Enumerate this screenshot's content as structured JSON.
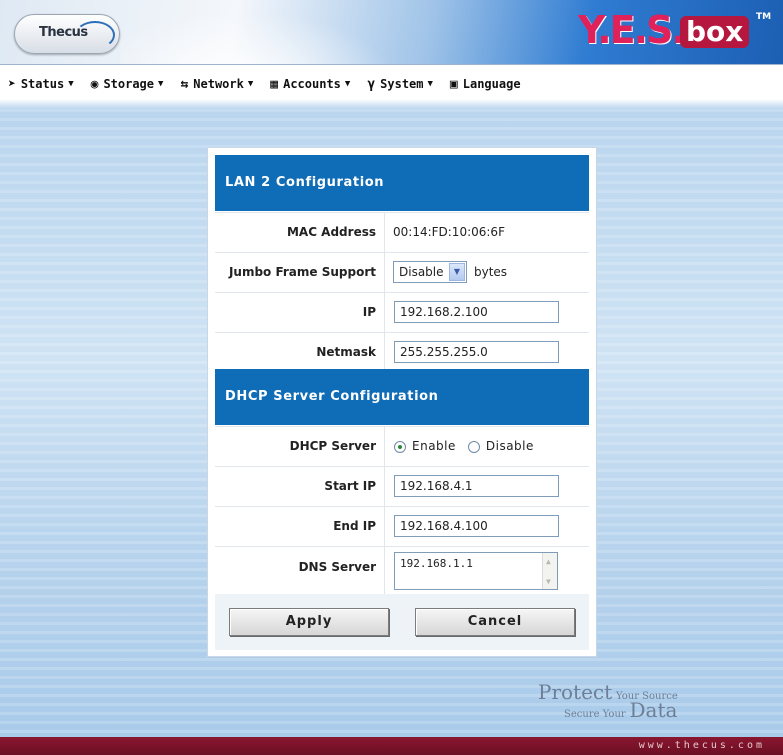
{
  "header": {
    "brand_left": "Thecus",
    "brand_right_yes": "Y.E.S.",
    "brand_right_box": "box",
    "brand_tm": "TM"
  },
  "menu": [
    {
      "label": "Status",
      "icon": "status-icon"
    },
    {
      "label": "Storage",
      "icon": "storage-icon"
    },
    {
      "label": "Network",
      "icon": "network-icon"
    },
    {
      "label": "Accounts",
      "icon": "accounts-icon"
    },
    {
      "label": "System",
      "icon": "system-icon"
    },
    {
      "label": "Language",
      "icon": "language-icon"
    }
  ],
  "lan": {
    "title": "LAN 2 Configuration",
    "mac_label": "MAC Address",
    "mac_value": "00:14:FD:10:06:6F",
    "jumbo_label": "Jumbo Frame Support",
    "jumbo_value": "Disable",
    "jumbo_unit": "bytes",
    "ip_label": "IP",
    "ip_value": "192.168.2.100",
    "netmask_label": "Netmask",
    "netmask_value": "255.255.255.0"
  },
  "dhcp": {
    "title": "DHCP Server Configuration",
    "server_label": "DHCP Server",
    "enable_label": "Enable",
    "disable_label": "Disable",
    "selected": "Enable",
    "start_label": "Start IP",
    "start_value": "192.168.4.1",
    "end_label": "End IP",
    "end_value": "192.168.4.100",
    "dns_label": "DNS Server",
    "dns_value": "192.168.1.1"
  },
  "buttons": {
    "apply": "Apply",
    "cancel": "Cancel"
  },
  "footer": {
    "protect": "Protect",
    "your_source": "Your Source",
    "secure_your": "Secure Your",
    "data": "Data",
    "url": "www.thecus.com"
  },
  "colors": {
    "section_header": "#0f6cb6",
    "footer": "#7a1229",
    "brand_pink": "#e0215a"
  }
}
